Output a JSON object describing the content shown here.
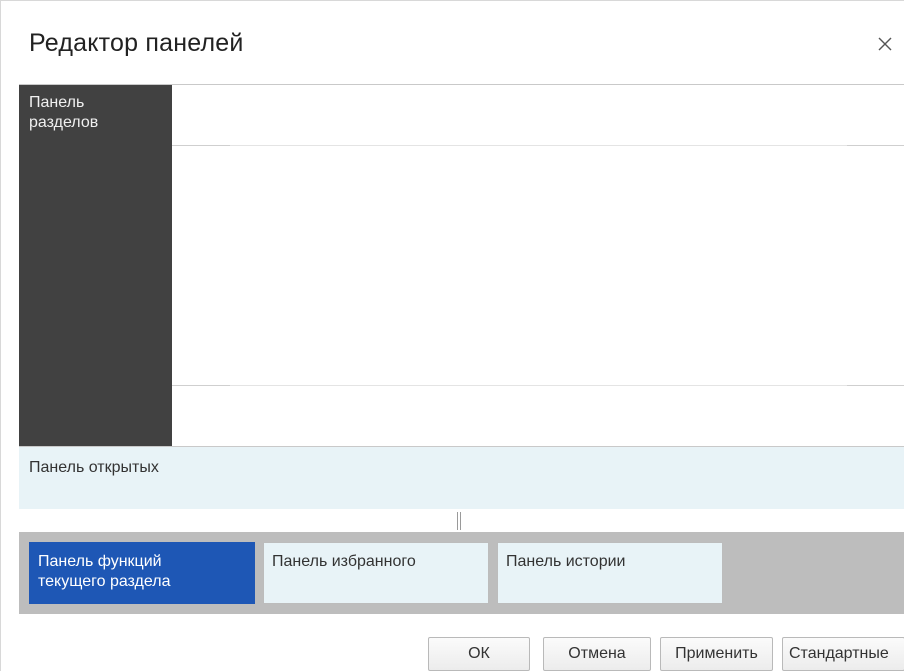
{
  "dialog": {
    "title": "Редактор панелей",
    "close_icon": "close-icon"
  },
  "editor": {
    "sections_panel": {
      "line1": "Панель",
      "line2": "разделов"
    },
    "open_panel": {
      "label": "Панель открытых"
    },
    "function_panels": [
      {
        "line1": "Панель функций",
        "line2": "текущего раздела",
        "active": true
      },
      {
        "line1": "Панель избранного",
        "line2": "",
        "active": false
      },
      {
        "line1": "Панель истории",
        "line2": "",
        "active": false
      }
    ]
  },
  "buttons": {
    "ok": "ОК",
    "cancel": "Отмена",
    "apply": "Применить",
    "defaults": "Стандартные"
  },
  "colors": {
    "sections_panel_bg": "#414141",
    "open_panel_bg": "#e8f3f7",
    "functions_row_bg": "#bdbdbd",
    "active_panel_bg": "#1e57b5"
  }
}
